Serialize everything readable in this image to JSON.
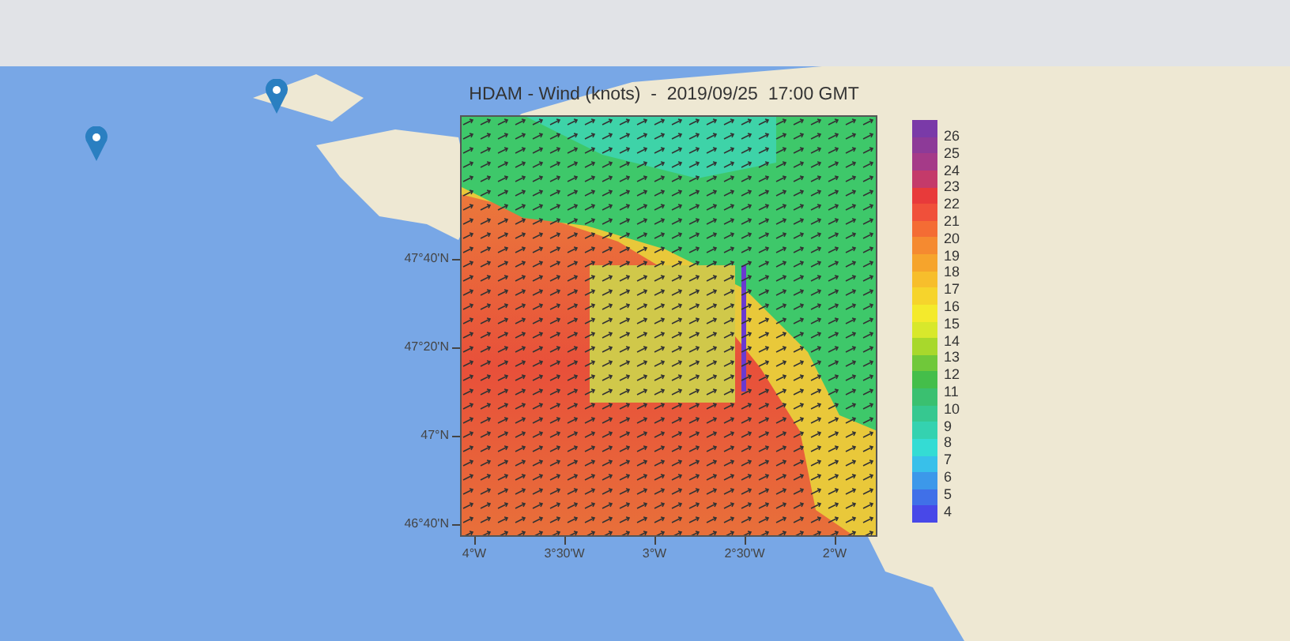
{
  "overlay": {
    "title": "HDAM - Wind (knots)  -  2019/09/25  17:00 GMT",
    "colorbar": {
      "labels": [
        "26",
        "25",
        "24",
        "23",
        "22",
        "21",
        "20",
        "19",
        "18",
        "17",
        "16",
        "15",
        "14",
        "13",
        "12",
        "11",
        "10",
        "9",
        "8",
        "7",
        "6",
        "5",
        "4"
      ]
    },
    "x_axis": {
      "ticks": [
        "4°W",
        "3°30'W",
        "3°W",
        "2°30'W",
        "2°W"
      ]
    },
    "y_axis": {
      "ticks": [
        "47°40'N",
        "47°20'N",
        "47°N",
        "46°40'N"
      ]
    }
  }
}
